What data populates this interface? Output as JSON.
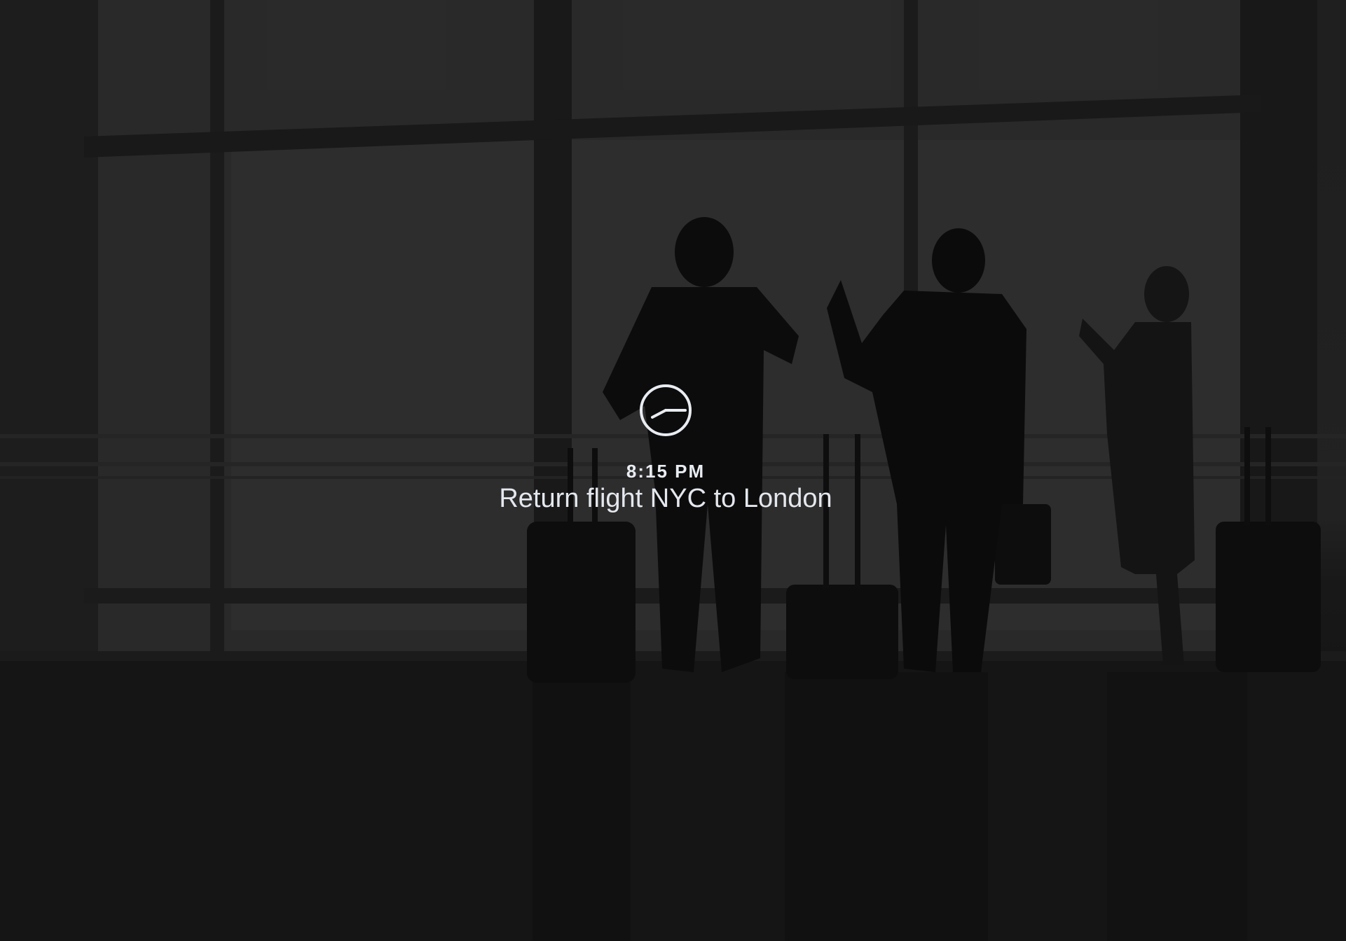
{
  "event": {
    "time": "8:15 PM",
    "title": "Return flight NYC to London",
    "icon": "clock-icon"
  },
  "colors": {
    "text": "#e9edf2",
    "background": "#262626"
  }
}
